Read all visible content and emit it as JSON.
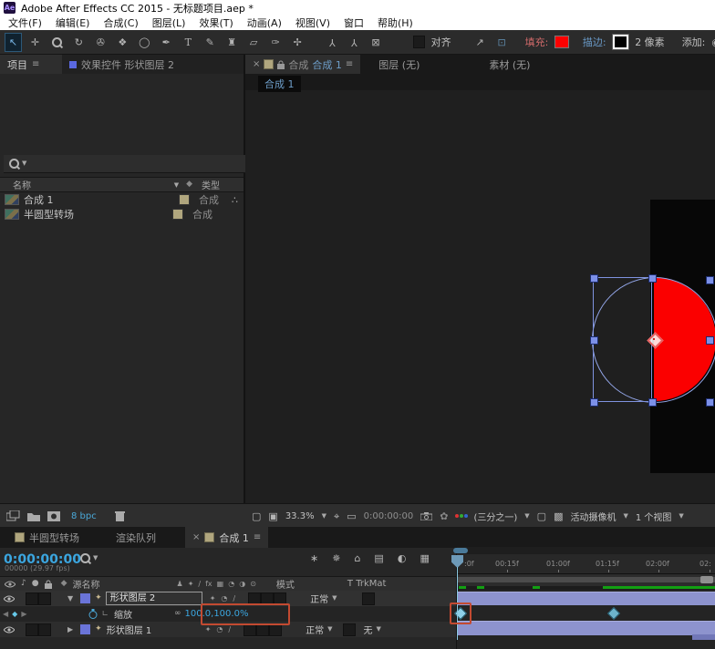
{
  "window": {
    "icon_text": "Ae",
    "title": "Adobe After Effects CC 2015 - 无标题项目.aep *"
  },
  "menubar": {
    "items": [
      "文件(F)",
      "编辑(E)",
      "合成(C)",
      "图层(L)",
      "效果(T)",
      "动画(A)",
      "视图(V)",
      "窗口",
      "帮助(H)"
    ]
  },
  "toolbar": {
    "snap_label": "对齐",
    "fill_label": "填充:",
    "stroke_label": "描边:",
    "stroke_width": "2 像素",
    "add_label": "添加:",
    "fill_color": "#fb0000",
    "stroke_color": "#000000"
  },
  "icons": {
    "selection": "↖",
    "hand": "✛",
    "rotate": "↻",
    "camera": "✇",
    "pan_behind": "❖",
    "shape": "◯",
    "pen": "✒",
    "type": "T",
    "brush": "✎",
    "clone_stamp": "♜",
    "eraser": "▱",
    "roto_brush": "✑",
    "puppet_pin": "✢",
    "axis": "Y",
    "axis_box": "⊠",
    "node": "↗",
    "region": "⊡",
    "panel_menu": "≡",
    "close": "×",
    "sort_desc": "▼",
    "caret_down": "▼",
    "expand_open": "▼",
    "expand_closed": "▶",
    "tag": "◆",
    "flowchart": "∴",
    "speaker": "♪",
    "solo": "●",
    "shape_layer_star": "✦",
    "link": "∞",
    "slash": "∕",
    "kf_prev": "◀",
    "kf_next": "▶",
    "monitor": "▢",
    "monitor2": "▣",
    "target": "⌖",
    "mask": "▭",
    "flower": "✿",
    "grid": "▩",
    "add_circle": "◉",
    "comp_mini_flowchart": "∗",
    "draft_3d": "✵",
    "shy": "⌂",
    "frame_blend": "▤",
    "motion_blur": "◐",
    "graph_editor": "▦",
    "sw_shy": "♟",
    "sw_collapse": "✦",
    "sw_fx": "fx",
    "sw_blend": "▦",
    "sw_blur": "◔",
    "sw_adjust": "◑",
    "sw_3d": "⊙"
  },
  "project": {
    "tab_project": "项目",
    "tab_effect_controls": "效果控件 形状图层 2",
    "col_name": "名称",
    "col_type": "类型",
    "rows": [
      {
        "name": "合成 1",
        "type": "合成"
      },
      {
        "name": "半圆型转场",
        "type": "合成"
      }
    ],
    "bpc": "8 bpc",
    "label_color": "#b0a67e"
  },
  "viewer": {
    "tab_prefix": "合成",
    "tab_comp_name": "合成 1",
    "tab_layer": "图层 (无)",
    "tab_footage": "素材 (无)",
    "breadcrumb": "合成 1",
    "zoom": "33.3%",
    "timecode": "0:00:00:00",
    "resolution": "(三分之一)",
    "camera": "活动摄像机",
    "views": "1 个视图"
  },
  "timeline": {
    "tab_semicircle": "半圆型转场",
    "tab_render_queue": "渲染队列",
    "tab_comp": "合成 1",
    "timecode": "0:00:00:00",
    "frame_info": "00000 (29.97 fps)",
    "col_source": "源名称",
    "col_mode": "模式",
    "col_trkmat": "T TrkMat",
    "layers": [
      {
        "name": "形状图层 2",
        "mode": "正常"
      },
      {
        "name": "形状图层 1",
        "mode": "正常",
        "trkmat": "无"
      }
    ],
    "scale_property": "缩放",
    "scale_value": "100.0,100.0%",
    "ruler": [
      ":0f",
      "00:15f",
      "01:00f",
      "01:15f",
      "02:00f",
      "02:"
    ]
  },
  "annotation_color": "#c34a31"
}
